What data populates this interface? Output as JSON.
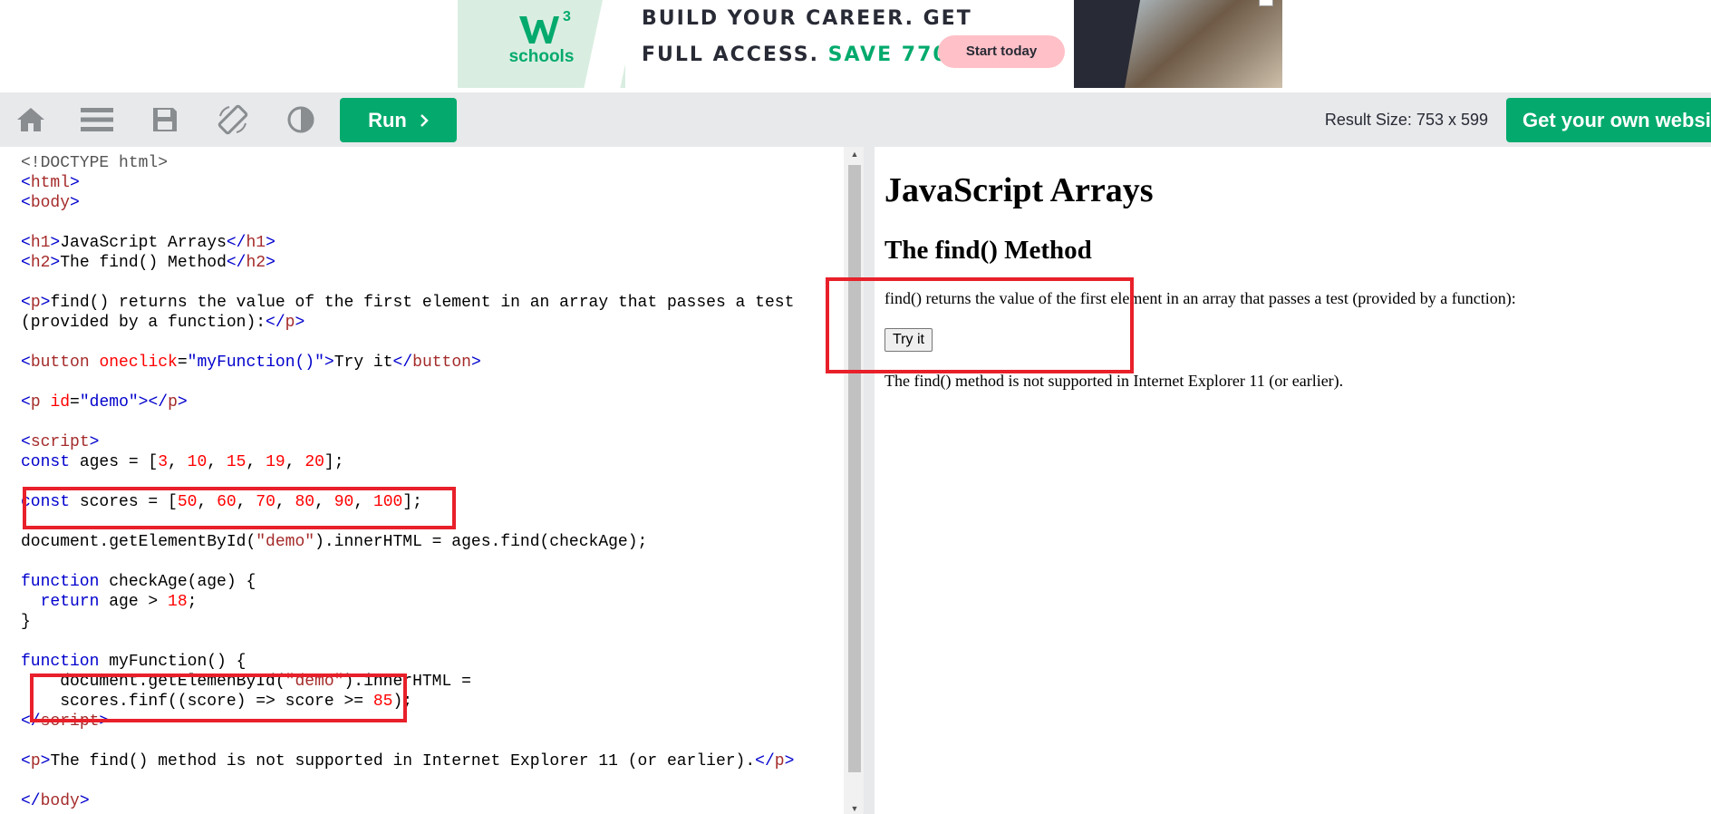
{
  "ad": {
    "logo_text": "schools",
    "logo_sup": "3",
    "line1": "BUILD YOUR CAREER. GET",
    "line2_prefix": "FULL ACCESS.",
    "line2_save": "SAVE 770$",
    "cta": "Start today"
  },
  "toolbar": {
    "icons": [
      "home-icon",
      "menu-icon",
      "save-icon",
      "rotate-icon",
      "contrast-icon"
    ],
    "run_label": "Run",
    "run_icon": "chevron-right-icon",
    "result_size": "Result Size: 753 x 599",
    "own_website": "Get your own website"
  },
  "editor": {
    "lines": [
      [
        [
          "dt",
          "<!DOCTYPE html>"
        ]
      ],
      [
        [
          "br",
          "<"
        ],
        [
          "tag",
          "html"
        ],
        [
          "br",
          ">"
        ]
      ],
      [
        [
          "br",
          "<"
        ],
        [
          "tag",
          "body"
        ],
        [
          "br",
          ">"
        ]
      ],
      [],
      [
        [
          "br",
          "<"
        ],
        [
          "tag",
          "h1"
        ],
        [
          "br",
          ">"
        ],
        [
          "tx",
          "JavaScript Arrays"
        ],
        [
          "br",
          "</"
        ],
        [
          "tag",
          "h1"
        ],
        [
          "br",
          ">"
        ]
      ],
      [
        [
          "br",
          "<"
        ],
        [
          "tag",
          "h2"
        ],
        [
          "br",
          ">"
        ],
        [
          "tx",
          "The find() Method"
        ],
        [
          "br",
          "</"
        ],
        [
          "tag",
          "h2"
        ],
        [
          "br",
          ">"
        ]
      ],
      [],
      [
        [
          "br",
          "<"
        ],
        [
          "tag",
          "p"
        ],
        [
          "br",
          ">"
        ],
        [
          "tx",
          "find() returns the value of the first element in an array that passes a test"
        ]
      ],
      [
        [
          "tx",
          "(provided by a function):"
        ],
        [
          "br",
          "</"
        ],
        [
          "tag",
          "p"
        ],
        [
          "br",
          ">"
        ]
      ],
      [],
      [
        [
          "br",
          "<"
        ],
        [
          "tag",
          "button"
        ],
        [
          "tx",
          " "
        ],
        [
          "attr",
          "oneclick"
        ],
        [
          "tx",
          "="
        ],
        [
          "val",
          "\"myFunction()\""
        ],
        [
          "br",
          ">"
        ],
        [
          "tx",
          "Try it"
        ],
        [
          "br",
          "</"
        ],
        [
          "tag",
          "button"
        ],
        [
          "br",
          ">"
        ]
      ],
      [],
      [
        [
          "br",
          "<"
        ],
        [
          "tag",
          "p"
        ],
        [
          "tx",
          " "
        ],
        [
          "attr",
          "id"
        ],
        [
          "tx",
          "="
        ],
        [
          "val",
          "\"demo\""
        ],
        [
          "br",
          "></"
        ],
        [
          "tag",
          "p"
        ],
        [
          "br",
          ">"
        ]
      ],
      [],
      [
        [
          "br",
          "<"
        ],
        [
          "tag",
          "script"
        ],
        [
          "br",
          ">"
        ]
      ],
      [
        [
          "kw",
          "const"
        ],
        [
          "tx",
          " ages = ["
        ],
        [
          "num",
          "3"
        ],
        [
          "tx",
          ", "
        ],
        [
          "num",
          "10"
        ],
        [
          "tx",
          ", "
        ],
        [
          "num",
          "15"
        ],
        [
          "tx",
          ", "
        ],
        [
          "num",
          "19"
        ],
        [
          "tx",
          ", "
        ],
        [
          "num",
          "20"
        ],
        [
          "tx",
          "];"
        ]
      ],
      [],
      [
        [
          "kw",
          "const"
        ],
        [
          "tx",
          " scores = ["
        ],
        [
          "num",
          "50"
        ],
        [
          "tx",
          ", "
        ],
        [
          "num",
          "60"
        ],
        [
          "tx",
          ", "
        ],
        [
          "num",
          "70"
        ],
        [
          "tx",
          ", "
        ],
        [
          "num",
          "80"
        ],
        [
          "tx",
          ", "
        ],
        [
          "num",
          "90"
        ],
        [
          "tx",
          ", "
        ],
        [
          "num",
          "100"
        ],
        [
          "tx",
          "];"
        ]
      ],
      [],
      [
        [
          "tx",
          "document.getElementById("
        ],
        [
          "str",
          "\"demo\""
        ],
        [
          "tx",
          ").innerHTML = ages.find(checkAge);"
        ]
      ],
      [],
      [
        [
          "kw",
          "function"
        ],
        [
          "tx",
          " checkAge(age) {"
        ]
      ],
      [
        [
          "tx",
          "  "
        ],
        [
          "kw",
          "return"
        ],
        [
          "tx",
          " age > "
        ],
        [
          "num",
          "18"
        ],
        [
          "tx",
          ";"
        ]
      ],
      [
        [
          "tx",
          "}"
        ]
      ],
      [],
      [
        [
          "kw",
          "function"
        ],
        [
          "tx",
          " myFunction() {"
        ]
      ],
      [
        [
          "tx",
          "    document.getElemenById("
        ],
        [
          "str",
          "\"demo\""
        ],
        [
          "tx",
          ").innerHTML ="
        ]
      ],
      [
        [
          "tx",
          "    scores.finf((score) => score >= "
        ],
        [
          "num",
          "85"
        ],
        [
          "tx",
          ");"
        ]
      ],
      [
        [
          "br",
          "</"
        ],
        [
          "tag",
          "script"
        ],
        [
          "br",
          ">"
        ]
      ],
      [],
      [
        [
          "br",
          "<"
        ],
        [
          "tag",
          "p"
        ],
        [
          "br",
          ">"
        ],
        [
          "tx",
          "The find() method is not supported in Internet Explorer 11 (or earlier)."
        ],
        [
          "br",
          "</"
        ],
        [
          "tag",
          "p"
        ],
        [
          "br",
          ">"
        ]
      ],
      [],
      [
        [
          "br",
          "</"
        ],
        [
          "tag",
          "body"
        ],
        [
          "br",
          ">"
        ]
      ]
    ]
  },
  "result": {
    "h1": "JavaScript Arrays",
    "h2": "The find() Method",
    "p1": "find() returns the value of the first element in an array that passes a test (provided by a function):",
    "button": "Try it",
    "p2": "The find() method is not supported in Internet Explorer 11 (or earlier)."
  },
  "colors": {
    "accent": "#04aa6d",
    "toolbar_bg": "#e7e9eb",
    "highlight": "#e8202a",
    "tag": "#a52a2a",
    "keyword": "#0000cd",
    "number": "#ff0000"
  }
}
